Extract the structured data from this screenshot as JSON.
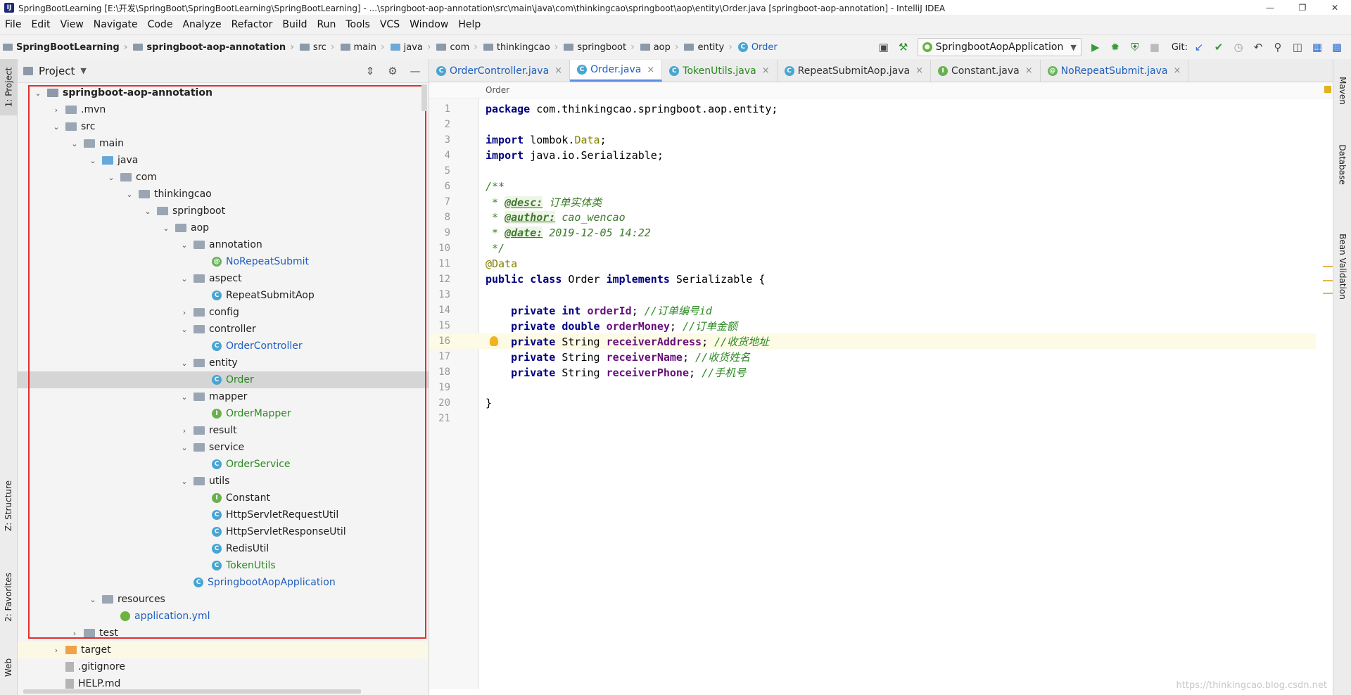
{
  "window": {
    "title": "SpringBootLearning [E:\\开发\\SpringBoot\\SpringBootLearning\\SpringBootLearning] - ...\\springboot-aop-annotation\\src\\main\\java\\com\\thinkingcao\\springboot\\aop\\entity\\Order.java [springboot-aop-annotation] - IntelliJ IDEA"
  },
  "menu": [
    "File",
    "Edit",
    "View",
    "Navigate",
    "Code",
    "Analyze",
    "Refactor",
    "Build",
    "Run",
    "Tools",
    "VCS",
    "Window",
    "Help"
  ],
  "breadcrumbs": [
    "SpringBootLearning",
    "springboot-aop-annotation",
    "src",
    "main",
    "java",
    "com",
    "thinkingcao",
    "springboot",
    "aop",
    "entity",
    "Order"
  ],
  "toolbar": {
    "run_config": "SpringbootAopApplication",
    "git_label": "Git:"
  },
  "left_stripe": {
    "project": "1: Project",
    "structure": "Z: Structure",
    "favorites": "2: Favorites",
    "web": "Web"
  },
  "right_stripe": {
    "maven": "Maven",
    "database": "Database",
    "bean_validation": "Bean Validation"
  },
  "project_panel": {
    "title": "Project",
    "tree": [
      {
        "label": "springboot-aop-annotation"
      },
      {
        "label": ".mvn"
      },
      {
        "label": "src"
      },
      {
        "label": "main"
      },
      {
        "label": "java"
      },
      {
        "label": "com"
      },
      {
        "label": "thinkingcao"
      },
      {
        "label": "springboot"
      },
      {
        "label": "aop"
      },
      {
        "label": "annotation"
      },
      {
        "label": "NoRepeatSubmit"
      },
      {
        "label": "aspect"
      },
      {
        "label": "RepeatSubmitAop"
      },
      {
        "label": "config"
      },
      {
        "label": "controller"
      },
      {
        "label": "OrderController"
      },
      {
        "label": "entity"
      },
      {
        "label": "Order"
      },
      {
        "label": "mapper"
      },
      {
        "label": "OrderMapper"
      },
      {
        "label": "result"
      },
      {
        "label": "service"
      },
      {
        "label": "OrderService"
      },
      {
        "label": "utils"
      },
      {
        "label": "Constant"
      },
      {
        "label": "HttpServletRequestUtil"
      },
      {
        "label": "HttpServletResponseUtil"
      },
      {
        "label": "RedisUtil"
      },
      {
        "label": "TokenUtils"
      },
      {
        "label": "SpringbootAopApplication"
      },
      {
        "label": "resources"
      },
      {
        "label": "application.yml"
      },
      {
        "label": "test"
      },
      {
        "label": "target"
      },
      {
        "label": ".gitignore"
      },
      {
        "label": "HELP.md"
      }
    ]
  },
  "tabs": [
    {
      "label": "OrderController.java"
    },
    {
      "label": "Order.java"
    },
    {
      "label": "TokenUtils.java"
    },
    {
      "label": "RepeatSubmitAop.java"
    },
    {
      "label": "Constant.java"
    },
    {
      "label": "NoRepeatSubmit.java"
    }
  ],
  "editor": {
    "structure_crumb": "Order",
    "line_numbers": [
      "1",
      "2",
      "3",
      "4",
      "5",
      "6",
      "7",
      "8",
      "9",
      "10",
      "11",
      "12",
      "13",
      "14",
      "15",
      "16",
      "17",
      "18",
      "19",
      "20",
      "21"
    ],
    "code": {
      "l1_kw": "package",
      "l1_rest": " com.thinkingcao.springboot.aop.entity;",
      "l3_kw": "import",
      "l3_pkg": " lombok.",
      "l3_ann": "Data",
      "l3_end": ";",
      "l4_kw": "import",
      "l4_rest": " java.io.Serializable;",
      "l6": "/**",
      "l7_pre": " * ",
      "l7_tag": "@desc:",
      "l7_text": " 订单实体类",
      "l8_pre": " * ",
      "l8_tag": "@author:",
      "l8_text": " cao_wencao",
      "l9_pre": " * ",
      "l9_tag": "@date:",
      "l9_text": " 2019-12-05 14:22",
      "l10": " */",
      "l11": "@Data",
      "l12_kw1": "public class",
      "l12_name": " Order ",
      "l12_kw2": "implements",
      "l12_rest": " Serializable {",
      "l14_kw": "    private int",
      "l14_fld": " orderId",
      "l14_semi": "; ",
      "l14_cmt": "//订单编号id",
      "l15_kw": "    private double",
      "l15_fld": " orderMoney",
      "l15_semi": "; ",
      "l15_cmt": "//订单金额",
      "l16_kw": "    private",
      "l16_type": " String",
      "l16_fld": " receiverAddress",
      "l16_semi": "; ",
      "l16_cmt": "//收货地址",
      "l17_kw": "    private",
      "l17_type": " String",
      "l17_fld": " receiverName",
      "l17_semi": "; ",
      "l17_cmt": "//收货姓名",
      "l18_kw": "    private",
      "l18_type": " String",
      "l18_fld": " receiverPhone",
      "l18_semi": "; ",
      "l18_cmt": "//手机号",
      "l20": "}"
    }
  },
  "watermark": "https://thinkingcao.blog.csdn.net"
}
